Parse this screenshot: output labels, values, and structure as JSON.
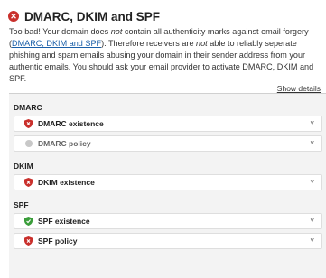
{
  "header": {
    "title": "DMARC, DKIM and SPF",
    "icon": "error-x-icon",
    "icon_color": "#c9302c"
  },
  "description": {
    "part1": "Too bad! Your domain does ",
    "not1": "not",
    "part2": " contain all authenticity marks against email forgery (",
    "link": "DMARC, DKIM and SPF",
    "part3": "). Therefore receivers are ",
    "not2": "not",
    "part4": " able to reliably seperate phishing and spam emails abusing your domain in their sender address from your authentic emails. You should ask your email provider to activate DMARC, DKIM and SPF."
  },
  "show_details_label": "Show details",
  "groups": {
    "dmarc": {
      "label": "DMARC",
      "items": [
        {
          "label": "DMARC existence",
          "status": "fail"
        },
        {
          "label": "DMARC policy",
          "status": "neutral"
        }
      ]
    },
    "dkim": {
      "label": "DKIM",
      "items": [
        {
          "label": "DKIM existence",
          "status": "fail"
        }
      ]
    },
    "spf": {
      "label": "SPF",
      "items": [
        {
          "label": "SPF existence",
          "status": "pass"
        },
        {
          "label": "SPF policy",
          "status": "fail"
        }
      ]
    }
  },
  "colors": {
    "fail": "#c9302c",
    "pass": "#3a9d3a",
    "neutral": "#c8c8c8",
    "link": "#1a5fa8"
  },
  "chevron_glyph": "˅"
}
